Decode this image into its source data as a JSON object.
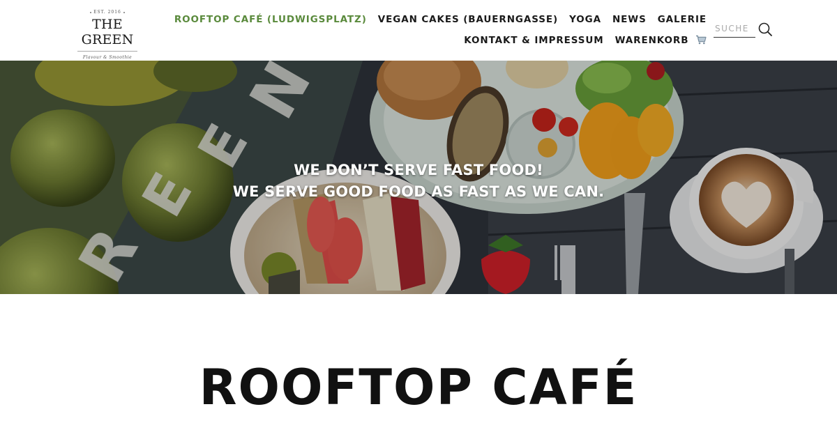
{
  "logo": {
    "est": "EST. 2016",
    "name": "THE GREEN",
    "tagline": "Flavour & Smoothie"
  },
  "nav": {
    "row1": [
      {
        "label": "ROOFTOP CAFÉ (LUDWIGSPLATZ)",
        "active": true
      },
      {
        "label": "VEGAN CAKES (BAUERNGASSE)",
        "active": false
      },
      {
        "label": "YOGA",
        "active": false
      },
      {
        "label": "NEWS",
        "active": false
      },
      {
        "label": "GALERIE",
        "active": false
      }
    ],
    "row2": [
      {
        "label": "KONTAKT & IMPRESSUM",
        "active": false
      },
      {
        "label": "WARENKORB",
        "active": false
      }
    ],
    "active_color": "#5a8a3c"
  },
  "search": {
    "placeholder": "SUCHE",
    "icon": "search-icon"
  },
  "hero": {
    "line1": "WE DON’T SERVE FAST FOOD!",
    "line2": "WE SERVE GOOD FOOD AS FAST AS WE CAN."
  },
  "main": {
    "title": "ROOFTOP CAFÉ"
  }
}
